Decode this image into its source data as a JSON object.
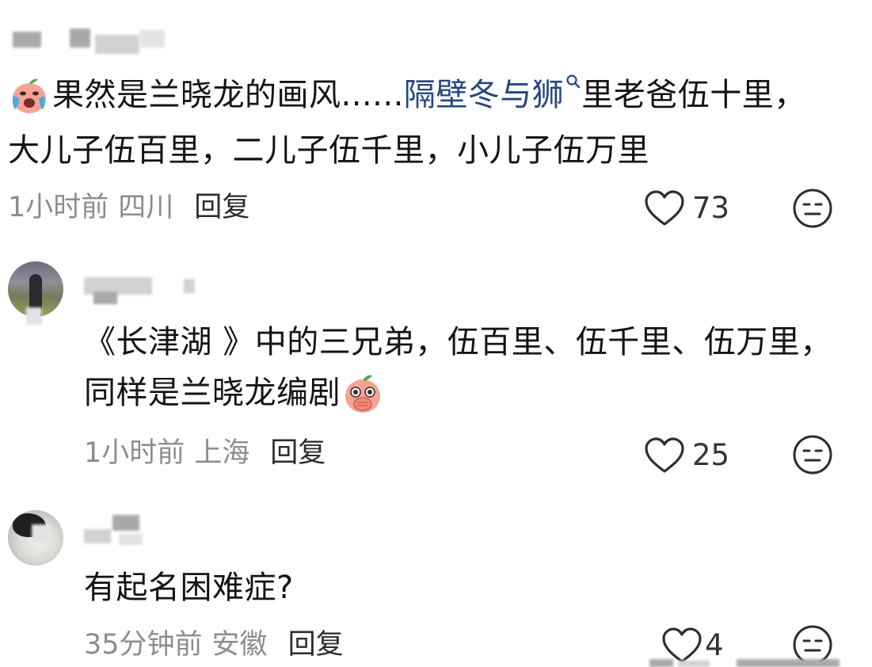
{
  "comments": [
    {
      "text_part1": "果然是兰晓龙的画风...... ",
      "link": "隔壁冬与狮",
      "text_part2": " 里老爸伍十里，",
      "text_line2": "大儿子伍百里，二儿子伍千里，小儿子伍万里",
      "time": "1小时前",
      "location": "四川",
      "reply_label": "回复",
      "likes": "73"
    },
    {
      "text_line1": "《长津湖 》中的三兄弟，伍百里、伍千里、伍万里，",
      "text_line2": "同样是兰晓龙编剧",
      "time": "1小时前",
      "location": "上海",
      "reply_label": "回复",
      "likes": "25"
    },
    {
      "text_line1": "有起名困难症?",
      "time": "35分钟前",
      "location": "安徽",
      "reply_label": "回复",
      "likes": "4"
    }
  ],
  "icons": {
    "like": "heart-outline-icon",
    "dislike": "meh-face-icon",
    "emoji_crying": "crying-peach-emoji",
    "emoji_covering_mouth": "cover-mouth-peach-emoji",
    "search_hint": "search-hint-icon"
  },
  "colors": {
    "text": "#141414",
    "meta": "#8d8d8d",
    "link": "#24477f",
    "emoji_peach": "#f4a08f"
  }
}
